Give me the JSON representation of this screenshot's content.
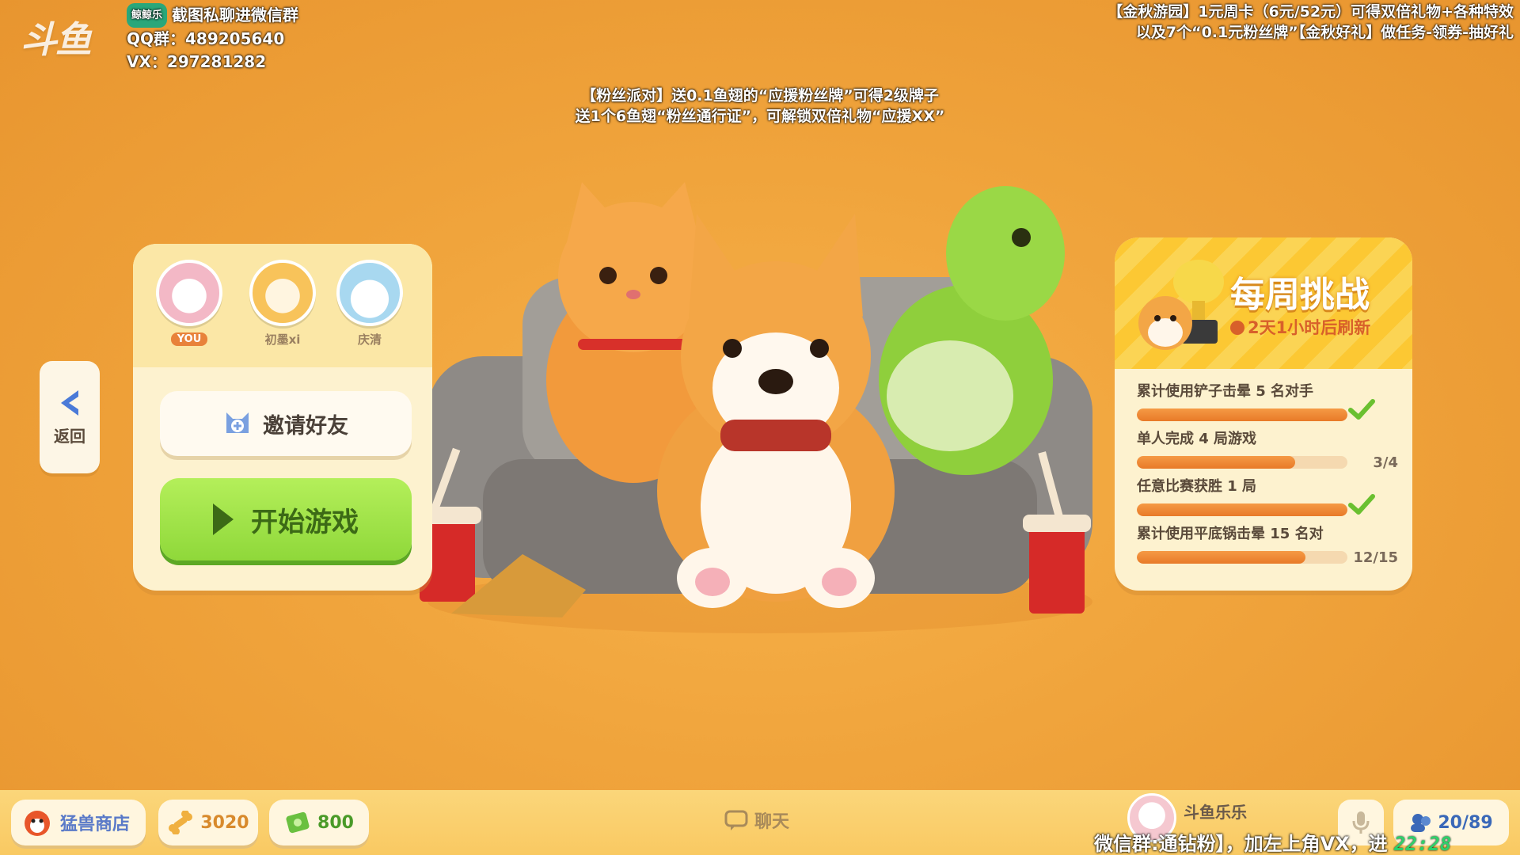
{
  "overlay": {
    "logo": "斗鱼",
    "tag": "鲸鲸乐",
    "info_line1": "截图私聊进微信群",
    "qq": "QQ群：489205640",
    "vx": "VX：297281282",
    "promo_right_1": "【金秋游园】1元周卡（6元/52元）可得双倍礼物+各种特效",
    "promo_right_2": "以及7个“0.1元粉丝牌”【金秋好礼】做任务-领券-抽好礼",
    "promo_center_1": "【粉丝派对】送0.1鱼翅的“应援粉丝牌”可得2级牌子",
    "promo_center_2": "送1个6鱼翅“粉丝通行证”，可解锁双倍礼物“应援XX”",
    "footer_promo": "微信群:通钻粉】，加左上角VX，进",
    "footer_clock": "22:28"
  },
  "nav": {
    "back_label": "返回"
  },
  "lobby": {
    "players": [
      {
        "name": "YOU",
        "is_self": true,
        "avatar": "bunny-avatar"
      },
      {
        "name": "初墨xi",
        "is_self": false,
        "avatar": "duck-avatar"
      },
      {
        "name": "庆清",
        "is_self": false,
        "avatar": "seal-avatar"
      }
    ],
    "invite_label": "邀请好友",
    "start_label": "开始游戏"
  },
  "weekly": {
    "title": "每周挑战",
    "refresh": "2天1小时后刷新",
    "tasks": [
      {
        "label": "累计使用铲子击晕 5 名对手",
        "progress": 1.0,
        "done": true,
        "count": ""
      },
      {
        "label": "单人完成 4 局游戏",
        "progress": 0.75,
        "done": false,
        "count": "3/4"
      },
      {
        "label": "任意比赛获胜 1 局",
        "progress": 1.0,
        "done": true,
        "count": ""
      },
      {
        "label": "累计使用平底锅击晕 15 名对",
        "progress": 0.8,
        "done": false,
        "count": "12/15"
      }
    ]
  },
  "bottom": {
    "shop_label": "猛兽商店",
    "bones": "3020",
    "cash": "800",
    "chat_label": "聊天",
    "user_name": "斗鱼乐乐",
    "player_count": "20/89"
  },
  "colors": {
    "accent_green": "#8fd83a",
    "accent_orange": "#e87a28",
    "panel": "#fdf2cf"
  }
}
